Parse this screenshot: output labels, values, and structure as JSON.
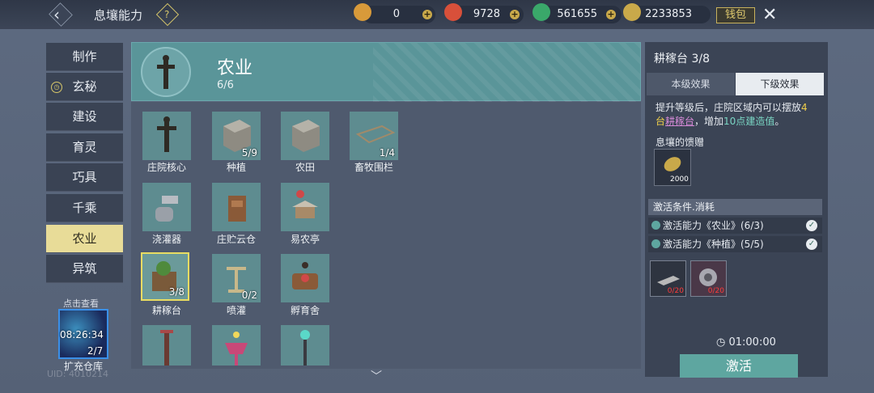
{
  "header": {
    "title": "息壤能力",
    "help_glyph": "?"
  },
  "currencies": [
    {
      "icon": "gold-token-icon",
      "value": "0",
      "color": "#d89a3a"
    },
    {
      "icon": "red-spiral-icon",
      "value": "9728",
      "color": "#d8503a"
    },
    {
      "icon": "jade-ring-icon",
      "value": "561655",
      "color": "#3aa86a"
    },
    {
      "icon": "gold-leaf-icon",
      "value": "2233853",
      "color": "#c9a94a"
    }
  ],
  "bag_label": "钱包",
  "tabs": [
    {
      "label": "制作"
    },
    {
      "label": "玄秘"
    },
    {
      "label": "建设"
    },
    {
      "label": "育灵"
    },
    {
      "label": "巧具"
    },
    {
      "label": "千乘"
    },
    {
      "label": "农业",
      "active": true
    },
    {
      "label": "异筑"
    }
  ],
  "expand": {
    "top_label": "点击查看",
    "time": "08:26:34",
    "count": "2/7",
    "label": "扩充仓库"
  },
  "banner": {
    "title": "农业",
    "progress": "6/6"
  },
  "items": [
    {
      "label": "庄院核心",
      "count": ""
    },
    {
      "label": "种植",
      "count": "5/9"
    },
    {
      "label": "农田",
      "count": ""
    },
    {
      "label": "畜牧围栏",
      "count": "1/4"
    },
    {
      "label": "浇灌器",
      "count": ""
    },
    {
      "label": "庄贮云仓",
      "count": ""
    },
    {
      "label": "易农亭",
      "count": ""
    },
    {
      "label": "耕稼台",
      "count": "3/8",
      "selected": true
    },
    {
      "label": "喷灌",
      "count": "0/2"
    },
    {
      "label": "孵育舍",
      "count": ""
    },
    {
      "label": "",
      "count": ""
    },
    {
      "label": "",
      "count": ""
    },
    {
      "label": "",
      "count": ""
    }
  ],
  "detail": {
    "title": "耕稼台 3/8",
    "tab_current": "本级效果",
    "tab_next": "下级效果",
    "desc_a": "提升等级后，庄院区域内可以摆放",
    "desc_num": "4",
    "desc_b": "台",
    "desc_link": "耕稼台",
    "desc_c": "，增加",
    "desc_val": "10点建造值",
    "desc_d": "。",
    "gift_label": "息壤的馈赠",
    "gift_value": "2000",
    "cond_header": "激活条件.消耗",
    "conditions": [
      {
        "text": "激活能力《农业》(6/3)"
      },
      {
        "text": "激活能力《种植》(5/5)"
      }
    ],
    "materials": [
      {
        "value": "0/20"
      },
      {
        "value": "0/20"
      }
    ],
    "timer": "01:00:00",
    "action": "激活"
  },
  "watermark": "UID: 4010214"
}
